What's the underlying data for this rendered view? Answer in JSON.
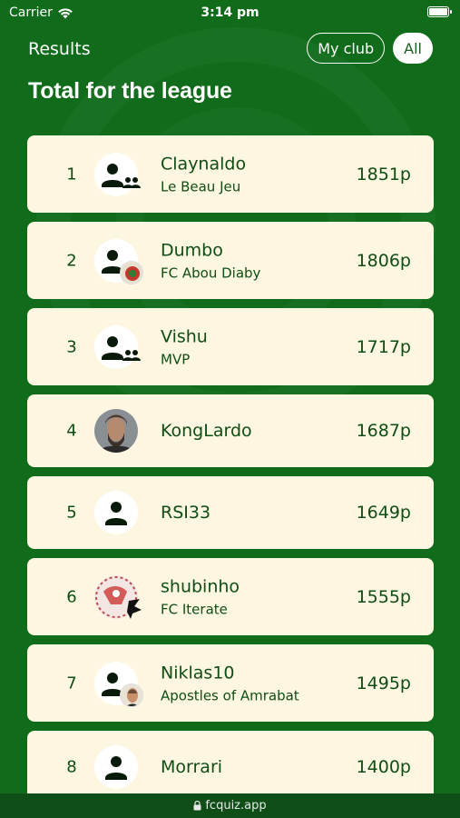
{
  "status_bar": {
    "carrier": "Carrier",
    "time": "3:14 pm"
  },
  "header": {
    "title": "Results",
    "filters": [
      {
        "label": "My club",
        "active": false
      },
      {
        "label": "All",
        "active": true
      }
    ]
  },
  "page_title": "Total for the league",
  "rows": [
    {
      "rank": "1",
      "name": "Claynaldo",
      "club": "Le Beau Jeu",
      "points": "1851p",
      "avatar": "person-icon",
      "badge": "group-icon"
    },
    {
      "rank": "2",
      "name": "Dumbo",
      "club": "FC Abou Diaby",
      "points": "1806p",
      "avatar": "person-icon",
      "badge": "club-crest"
    },
    {
      "rank": "3",
      "name": "Vishu",
      "club": "MVP",
      "points": "1717p",
      "avatar": "person-icon",
      "badge": "group-icon"
    },
    {
      "rank": "4",
      "name": "KongLardo",
      "club": "",
      "points": "1687p",
      "avatar": "user-photo",
      "badge": ""
    },
    {
      "rank": "5",
      "name": "RSI33",
      "club": "",
      "points": "1649p",
      "avatar": "person-icon",
      "badge": ""
    },
    {
      "rank": "6",
      "name": "shubinho",
      "club": "FC Iterate",
      "points": "1555p",
      "avatar": "club-logo",
      "badge": ""
    },
    {
      "rank": "7",
      "name": "Niklas10",
      "club": "Apostles of Amrabat",
      "points": "1495p",
      "avatar": "person-icon",
      "badge": "face-photo"
    },
    {
      "rank": "8",
      "name": "Morrari",
      "club": "",
      "points": "1400p",
      "avatar": "person-icon",
      "badge": ""
    }
  ],
  "footer": {
    "url": "fcquiz.app",
    "icon": "lock-icon"
  },
  "colors": {
    "background": "#106c1a",
    "card": "#fdf6e1",
    "text_dark": "#0f4d14"
  }
}
